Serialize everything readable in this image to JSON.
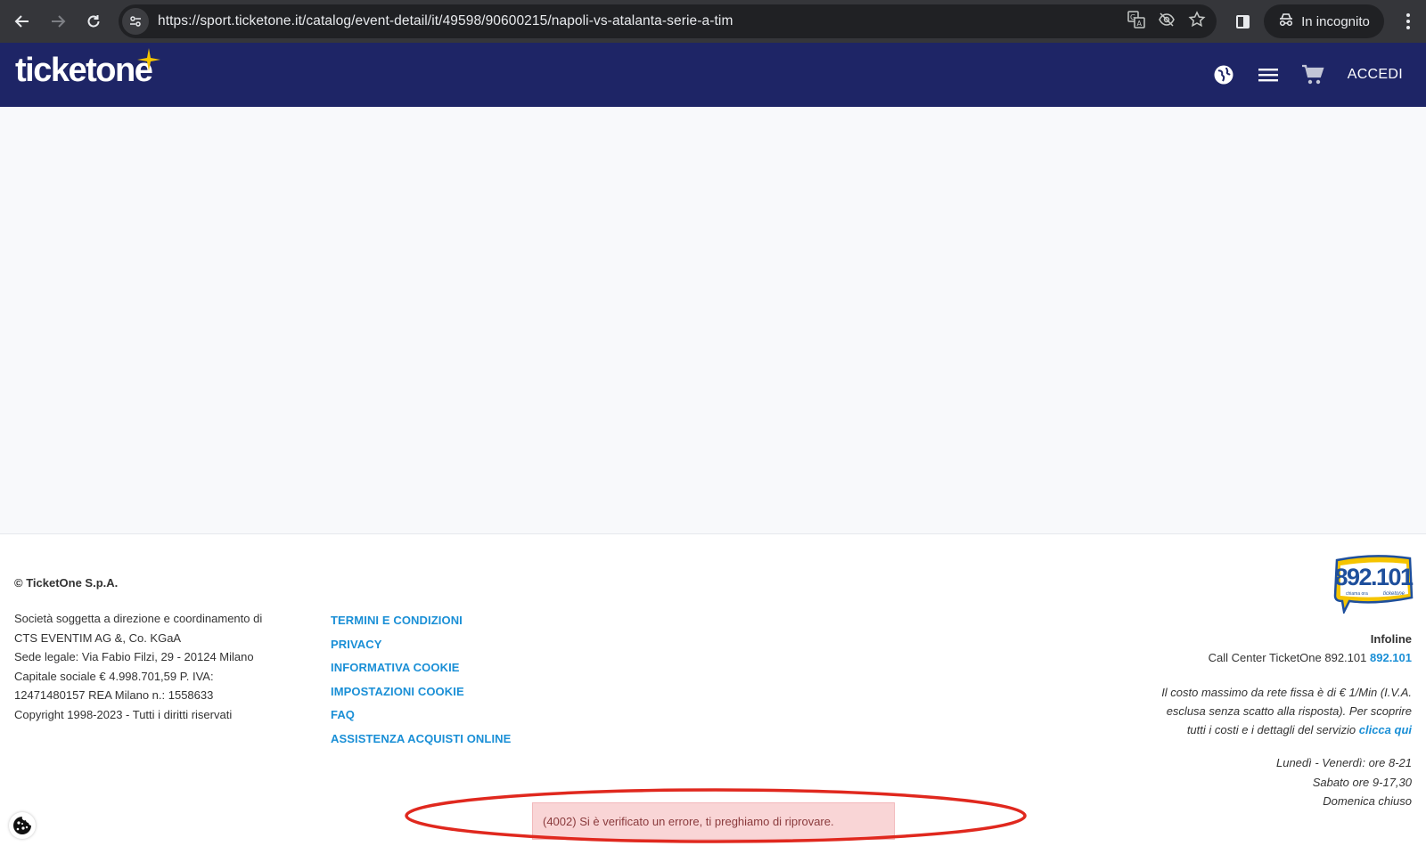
{
  "browser": {
    "url": "https://sport.ticketone.it/catalog/event-detail/it/49598/90600215/napoli-vs-atalanta-serie-a-tim",
    "incognito_label": "In incognito",
    "icons": [
      "back-arrow-icon",
      "forward-arrow-icon",
      "reload-icon",
      "site-info-icon",
      "translate-icon",
      "eye-off-icon",
      "star-icon",
      "side-panel-icon",
      "incognito-icon",
      "kebab-menu-icon"
    ]
  },
  "header": {
    "logo_text": "ticketone",
    "login_label": "ACCEDI",
    "brand_color": "#1e2566",
    "icons": [
      "globe-icon",
      "hamburger-menu-icon",
      "cart-icon"
    ]
  },
  "footer": {
    "company": "© TicketOne S.p.A.",
    "legal_lines": [
      "Società soggetta a direzione e coordinamento di",
      "CTS EVENTIM AG &, Co. KGaA",
      "Sede legale: Via Fabio Filzi, 29 - 20124 Milano",
      "Capitale sociale € 4.998.701,59 P. IVA:",
      "12471480157 REA Milano n.: 1558633",
      "Copyright 1998-2023 - Tutti i diritti riservati"
    ],
    "links": [
      "TERMINI E CONDIZIONI",
      "PRIVACY",
      "INFORMATIVA COOKIE",
      "IMPOSTAZIONI COOKIE",
      "FAQ",
      "ASSISTENZA ACQUISTI ONLINE"
    ],
    "link_color": "#1a8fd6",
    "hotline_logo": {
      "number": "892.101",
      "small_left": "chiama ora",
      "small_right": "ticketone"
    },
    "infoline_title": "Infoline",
    "callcenter_text": "Call Center TicketOne 892.101",
    "callcenter_number": "892.101",
    "cost_line1": "Il costo massimo da rete fissa è di € 1/Min (I.V.A.",
    "cost_line2": "esclusa senza scatto alla risposta). Per scoprire",
    "cost_line3": "tutti i costi e i dettagli del servizio",
    "cost_link": "clicca qui",
    "hours": [
      "Lunedì - Venerdì: ore 8-21",
      "Sabato ore 9-17,30",
      "Domenica chiuso"
    ]
  },
  "error_toast": {
    "message": "(4002) Si è verificato un errore, ti preghiamo di riprovare.",
    "background": "#f9d5d6"
  },
  "annotation": {
    "color": "#e0281e"
  }
}
